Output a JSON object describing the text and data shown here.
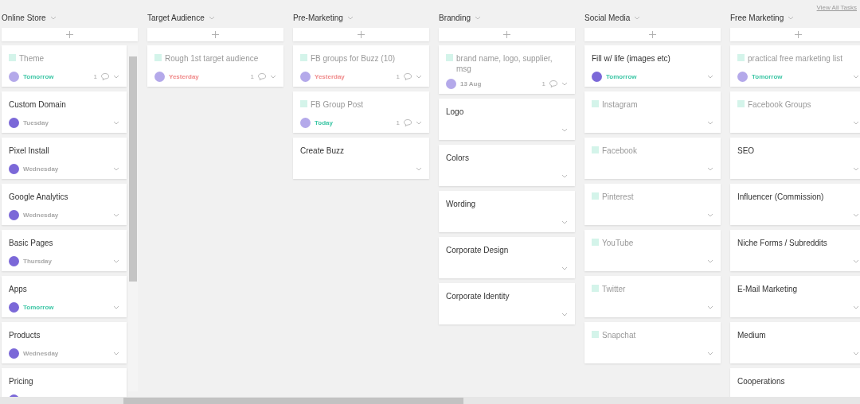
{
  "view_all_link": "View All Tasks",
  "columns": [
    {
      "title": "Online Store",
      "scrollable": true,
      "cards": [
        {
          "title": "Theme",
          "done": true,
          "avatar": true,
          "due": {
            "text": "Tomorrow",
            "color": "#3cc6a5"
          },
          "comments": "1"
        },
        {
          "title": "Custom Domain",
          "done": false,
          "avatar": true,
          "due": {
            "text": "Tuesday",
            "color": "#a8a8a8"
          }
        },
        {
          "title": "Pixel Install",
          "done": false,
          "avatar": true,
          "due": {
            "text": "Wednesday",
            "color": "#a8a8a8"
          }
        },
        {
          "title": "Google Analytics",
          "done": false,
          "avatar": true,
          "due": {
            "text": "Wednesday",
            "color": "#a8a8a8"
          }
        },
        {
          "title": "Basic Pages",
          "done": false,
          "avatar": true,
          "due": {
            "text": "Thursday",
            "color": "#a8a8a8"
          }
        },
        {
          "title": "Apps",
          "done": false,
          "avatar": true,
          "due": {
            "text": "Tomorrow",
            "color": "#3cc6a5"
          }
        },
        {
          "title": "Products",
          "done": false,
          "avatar": true,
          "due": {
            "text": "Wednesday",
            "color": "#a8a8a8"
          }
        },
        {
          "title": "Pricing",
          "done": false,
          "avatar": true
        }
      ]
    },
    {
      "title": "Target Audience",
      "scrollable": false,
      "cards": [
        {
          "title": "Rough 1st target audience",
          "done": true,
          "avatar": true,
          "due": {
            "text": "Yesterday",
            "color": "#f08a8a"
          },
          "comments": "1"
        }
      ]
    },
    {
      "title": "Pre-Marketing",
      "scrollable": false,
      "cards": [
        {
          "title": "FB groups for Buzz (10)",
          "done": true,
          "avatar": true,
          "due": {
            "text": "Yesterday",
            "color": "#f08a8a"
          },
          "comments": "1"
        },
        {
          "title": "FB Group Post",
          "done": true,
          "avatar": true,
          "due": {
            "text": "Today",
            "color": "#3cc6a5"
          },
          "comments": "1"
        },
        {
          "title": "Create Buzz",
          "done": false,
          "avatar": false
        }
      ]
    },
    {
      "title": "Branding",
      "scrollable": false,
      "cards": [
        {
          "title": "brand name, logo, supplier, msg",
          "done": true,
          "avatar": true,
          "due": {
            "text": "13 Aug",
            "color": "#a8a8a8"
          },
          "comments": "1"
        },
        {
          "title": "Logo",
          "done": false,
          "avatar": false
        },
        {
          "title": "Colors",
          "done": false,
          "avatar": false
        },
        {
          "title": "Wording",
          "done": false,
          "avatar": false
        },
        {
          "title": "Corporate Design",
          "done": false,
          "avatar": false
        },
        {
          "title": "Corporate Identity",
          "done": false,
          "avatar": false
        }
      ]
    },
    {
      "title": "Social Media",
      "scrollable": false,
      "cards": [
        {
          "title": "Fill w/ life (images etc)",
          "done": false,
          "avatar": true,
          "due": {
            "text": "Tomorrow",
            "color": "#3cc6a5"
          }
        },
        {
          "title": "Instagram",
          "done": true,
          "avatar": false
        },
        {
          "title": "Facebook",
          "done": true,
          "avatar": false
        },
        {
          "title": "Pinterest",
          "done": true,
          "avatar": false
        },
        {
          "title": "YouTube",
          "done": true,
          "avatar": false
        },
        {
          "title": "Twitter",
          "done": true,
          "avatar": false
        },
        {
          "title": "Snapchat",
          "done": true,
          "avatar": false
        }
      ]
    },
    {
      "title": "Free Marketing",
      "scrollable": false,
      "cards": [
        {
          "title": "practical free marketing list",
          "done": true,
          "avatar": true,
          "due": {
            "text": "Tomorrow",
            "color": "#3cc6a5"
          }
        },
        {
          "title": "Facebook Groups",
          "done": true,
          "avatar": false
        },
        {
          "title": "SEO",
          "done": false,
          "avatar": false
        },
        {
          "title": "Influencer (Commission)",
          "done": false,
          "avatar": false
        },
        {
          "title": "Niche Forms / Subreddits",
          "done": false,
          "avatar": false
        },
        {
          "title": "E-Mail Marketing",
          "done": false,
          "avatar": false
        },
        {
          "title": "Medium",
          "done": false,
          "avatar": false
        },
        {
          "title": "Cooperations",
          "done": false,
          "avatar": false
        }
      ]
    }
  ]
}
